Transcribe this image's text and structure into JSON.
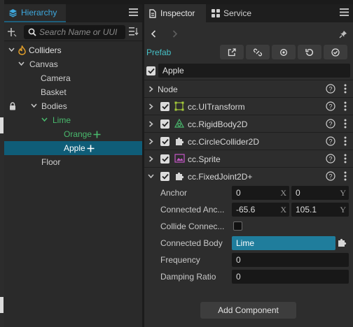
{
  "hierarchy": {
    "tab_label": "Hierarchy",
    "search_placeholder": "Search Name or UUI",
    "nodes": [
      {
        "label": "Colliders"
      },
      {
        "label": "Canvas"
      },
      {
        "label": "Camera"
      },
      {
        "label": "Basket"
      },
      {
        "label": "Bodies"
      },
      {
        "label": "Lime"
      },
      {
        "label": "Orange"
      },
      {
        "label": "Apple"
      },
      {
        "label": "Floor"
      }
    ]
  },
  "inspector": {
    "tabs": [
      {
        "label": "Inspector"
      },
      {
        "label": "Service"
      }
    ],
    "prefab_label": "Prefab",
    "node_name": "Apple",
    "node_section": "Node",
    "components": [
      {
        "label": "cc.UITransform",
        "icon": "transform-icon"
      },
      {
        "label": "cc.RigidBody2D",
        "icon": "rigidbody-icon"
      },
      {
        "label": "cc.CircleCollider2D",
        "icon": "puzzle-icon"
      },
      {
        "label": "cc.Sprite",
        "icon": "sprite-icon"
      },
      {
        "label": "cc.FixedJoint2D+",
        "icon": "puzzle-icon"
      }
    ],
    "props": {
      "anchor": {
        "label": "Anchor",
        "x": "0",
        "y": "0",
        "x_axis": "X",
        "y_axis": "Y"
      },
      "connected_anchor": {
        "label": "Connected Anc...",
        "x": "-65.6",
        "y": "105.1",
        "x_axis": "X",
        "y_axis": "Y"
      },
      "collide_connected": {
        "label": "Collide Connec...",
        "checked": false
      },
      "connected_body": {
        "label": "Connected Body",
        "value": "Lime"
      },
      "frequency": {
        "label": "Frequency",
        "value": "0"
      },
      "damping_ratio": {
        "label": "Damping Ratio",
        "value": "0"
      }
    },
    "add_component_label": "Add Component"
  },
  "colors": {
    "accent_blue": "#3ea9df",
    "selected_row": "#0f5d78",
    "green_label": "#49b96d",
    "prefab_teal": "#46c0c6",
    "object_field": "#1f7d9c"
  }
}
